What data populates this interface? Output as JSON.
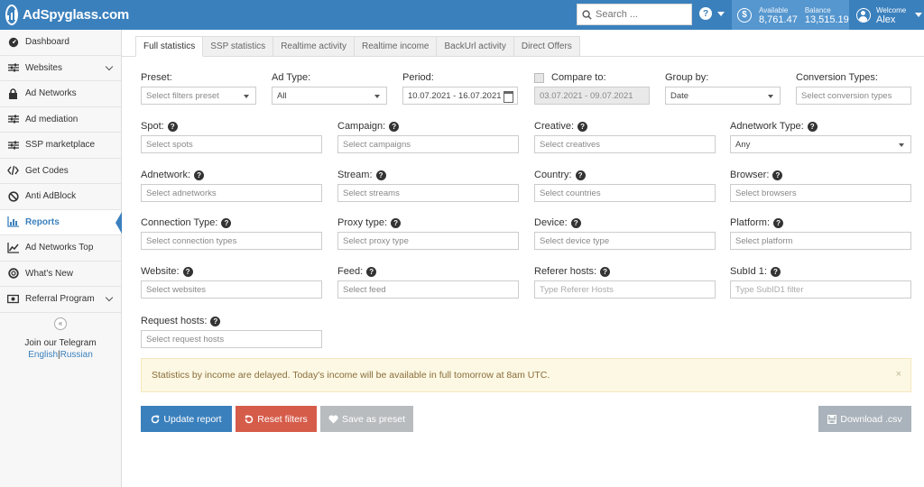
{
  "header": {
    "brand": "AdSpyglass.com",
    "search_placeholder": "Search ...",
    "help": "?",
    "available_label": "Available",
    "available_value": "8,761.47",
    "balance_label": "Balance",
    "balance_value": "13,515.19",
    "welcome_label": "Welcome",
    "user_name": "Alex",
    "dollar": "$"
  },
  "sidebar": {
    "items": [
      {
        "label": "Dashboard",
        "icon": "dashboard-icon"
      },
      {
        "label": "Websites",
        "icon": "sliders-icon"
      },
      {
        "label": "Ad Networks",
        "icon": "lock-icon"
      },
      {
        "label": "Ad mediation",
        "icon": "sliders-icon"
      },
      {
        "label": "SSP marketplace",
        "icon": "sliders-icon"
      },
      {
        "label": "Get Codes",
        "icon": "code-icon"
      },
      {
        "label": "Anti AdBlock",
        "icon": "ban-icon"
      },
      {
        "label": "Reports",
        "icon": "bar-chart-icon"
      },
      {
        "label": "Ad Networks Top",
        "icon": "line-chart-icon"
      },
      {
        "label": "What's New",
        "icon": "lifebuoy-icon"
      },
      {
        "label": "Referral Program",
        "icon": "money-icon"
      }
    ],
    "collapse": "«",
    "telegram_title": "Join our Telegram",
    "telegram_english": "English",
    "telegram_sep": "|",
    "telegram_russian": "Russian"
  },
  "tabs": [
    "Full statistics",
    "SSP statistics",
    "Realtime activity",
    "Realtime income",
    "BackUrl activity",
    "Direct Offers"
  ],
  "form": {
    "preset": {
      "label": "Preset:",
      "value": "Select filters preset"
    },
    "ad_type": {
      "label": "Ad Type:",
      "value": "All"
    },
    "period": {
      "label": "Period:",
      "value": "10.07.2021 - 16.07.2021"
    },
    "compare": {
      "label": "Compare to:",
      "value": "03.07.2021 - 09.07.2021"
    },
    "group_by": {
      "label": "Group by:",
      "value": "Date"
    },
    "conversion": {
      "label": "Conversion Types:",
      "value": "Select conversion types"
    },
    "spot": {
      "label": "Spot:",
      "value": "Select spots"
    },
    "campaign": {
      "label": "Campaign:",
      "value": "Select campaigns"
    },
    "creative": {
      "label": "Creative:",
      "value": "Select creatives"
    },
    "adnetwork_type": {
      "label": "Adnetwork Type:",
      "value": "Any"
    },
    "adnetwork": {
      "label": "Adnetwork:",
      "value": "Select adnetworks"
    },
    "stream": {
      "label": "Stream:",
      "value": "Select streams"
    },
    "country": {
      "label": "Country:",
      "value": "Select countries"
    },
    "browser": {
      "label": "Browser:",
      "value": "Select browsers"
    },
    "connection": {
      "label": "Connection Type:",
      "value": "Select connection types"
    },
    "proxy": {
      "label": "Proxy type:",
      "value": "Select proxy type"
    },
    "device": {
      "label": "Device:",
      "value": "Select device type"
    },
    "platform": {
      "label": "Platform:",
      "value": "Select platform"
    },
    "website": {
      "label": "Website:",
      "value": "Select websites"
    },
    "feed": {
      "label": "Feed:",
      "value": "Select feed"
    },
    "referer": {
      "label": "Referer hosts:",
      "placeholder": "Type Referer Hosts"
    },
    "subid": {
      "label": "SubId 1:",
      "placeholder": "Type SubID1 filter"
    },
    "request_hosts": {
      "label": "Request hosts:",
      "value": "Select request hosts"
    }
  },
  "alert": {
    "text": "Statistics by income are delayed. Today's income will be available in full tomorrow at 8am UTC.",
    "close": "×"
  },
  "buttons": {
    "update": "Update report",
    "reset": "Reset filters",
    "save": "Save as preset",
    "download": "Download .csv"
  },
  "colors": {
    "primary": "#3a80bd",
    "danger": "#d65c4a",
    "disabled": "#b9bcbf",
    "warning_bg": "#fcf8e3"
  }
}
